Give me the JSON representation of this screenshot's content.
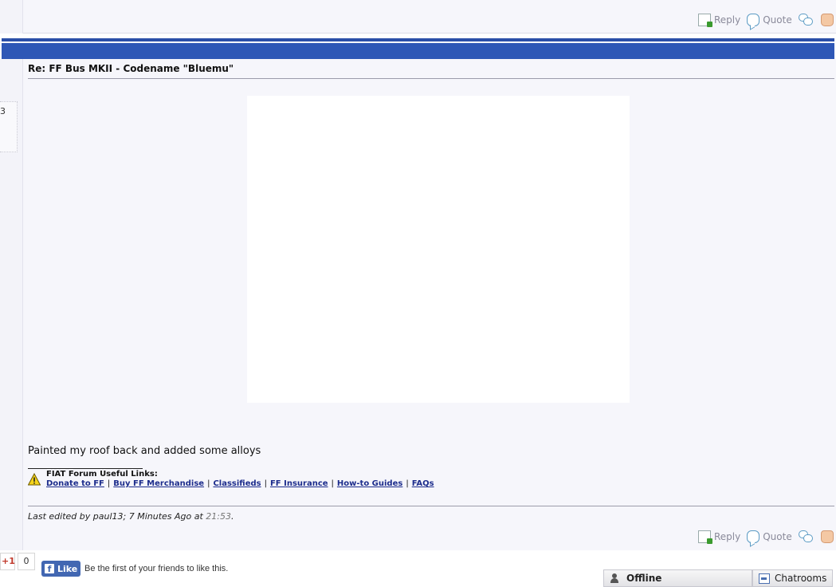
{
  "top_post": {
    "actions": {
      "reply": "Reply",
      "quote": "Quote"
    }
  },
  "post": {
    "left_fragment": "3",
    "title": "Re: FF Bus MKII - Codename \"Bluemu\"",
    "message": "Painted my roof back and added some alloys",
    "signature": {
      "heading": "FIAT Forum Useful Links:",
      "links": [
        "Donate to FF",
        "Buy FF Merchandise",
        "Classifieds",
        "FF Insurance",
        "How-to Guides",
        "FAQs"
      ],
      "separator": "|"
    },
    "edit_note": {
      "prefix": "Last edited by paul13; 7 Minutes Ago at ",
      "time": "21:53",
      "suffix": "."
    },
    "actions": {
      "reply": "Reply",
      "quote": "Quote"
    }
  },
  "social": {
    "gplus_label": "+1",
    "gplus_count": "0",
    "fb_like": "Like",
    "fb_text": "Be the first of your friends to like this."
  },
  "status_bar": {
    "offline": "Offline",
    "chatrooms": "Chatrooms"
  },
  "colors": {
    "blue_bar": "#2e57b6",
    "link": "#1c2c8c",
    "post_bg": "#f6f6fb",
    "facebook": "#4267b2"
  }
}
